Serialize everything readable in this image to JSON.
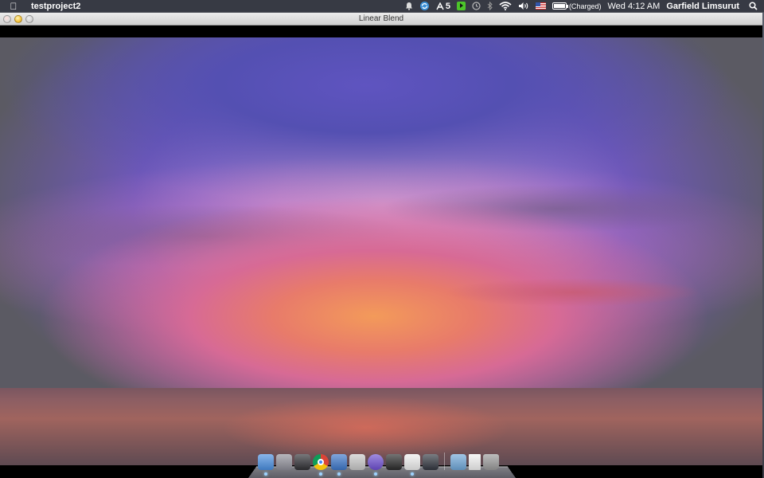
{
  "menubar": {
    "apple_icon": "apple-icon",
    "app_name": "testproject2",
    "extras": {
      "notification_icon": "bell-icon",
      "sync_icon": "sync-icon",
      "adobe_count": "5",
      "time_machine_icon": "clock-icon",
      "bluetooth_icon": "bluetooth-icon",
      "wifi_icon": "wifi-icon",
      "volume_icon": "speaker-icon",
      "input_flag": "us-flag-icon",
      "battery_label": "(Charged)",
      "battery_level": 1.0,
      "clock": "Wed 4:12 AM",
      "user": "Garfield Limsurut",
      "spotlight_icon": "magnifier-icon"
    }
  },
  "window": {
    "title": "Linear Blend"
  },
  "dock": {
    "apps": [
      {
        "name": "finder",
        "icon": "finder-icon",
        "color": "#4a8fe0",
        "running": true
      },
      {
        "name": "launchpad",
        "icon": "rocket-icon",
        "color": "#8f8f99",
        "running": false
      },
      {
        "name": "photo-booth",
        "icon": "photo-icon",
        "color": "#303034",
        "running": false
      },
      {
        "name": "chrome",
        "icon": "chrome-icon",
        "color": "#e6b52d",
        "running": true
      },
      {
        "name": "xcode",
        "icon": "hammer-icon",
        "color": "#3d77c9",
        "running": true
      },
      {
        "name": "preview",
        "icon": "preview-icon",
        "color": "#c8c8c8",
        "running": false
      },
      {
        "name": "cinema",
        "icon": "swirl-icon",
        "color": "#6e4fd1",
        "running": true
      },
      {
        "name": "terminal",
        "icon": "terminal-icon",
        "color": "#2a2a2a",
        "running": false
      },
      {
        "name": "textedit",
        "icon": "textedit-icon",
        "color": "#ededed",
        "running": true
      },
      {
        "name": "desktop",
        "icon": "monitor-icon",
        "color": "#333740",
        "running": false
      }
    ],
    "stacks": [
      {
        "name": "applications-folder",
        "icon": "folder-icon",
        "color": "#6fa7d8"
      },
      {
        "name": "documents",
        "icon": "document-icon",
        "color": "#f2f2f2"
      },
      {
        "name": "trash",
        "icon": "trash-icon",
        "color": "#9a9a9a"
      }
    ]
  }
}
